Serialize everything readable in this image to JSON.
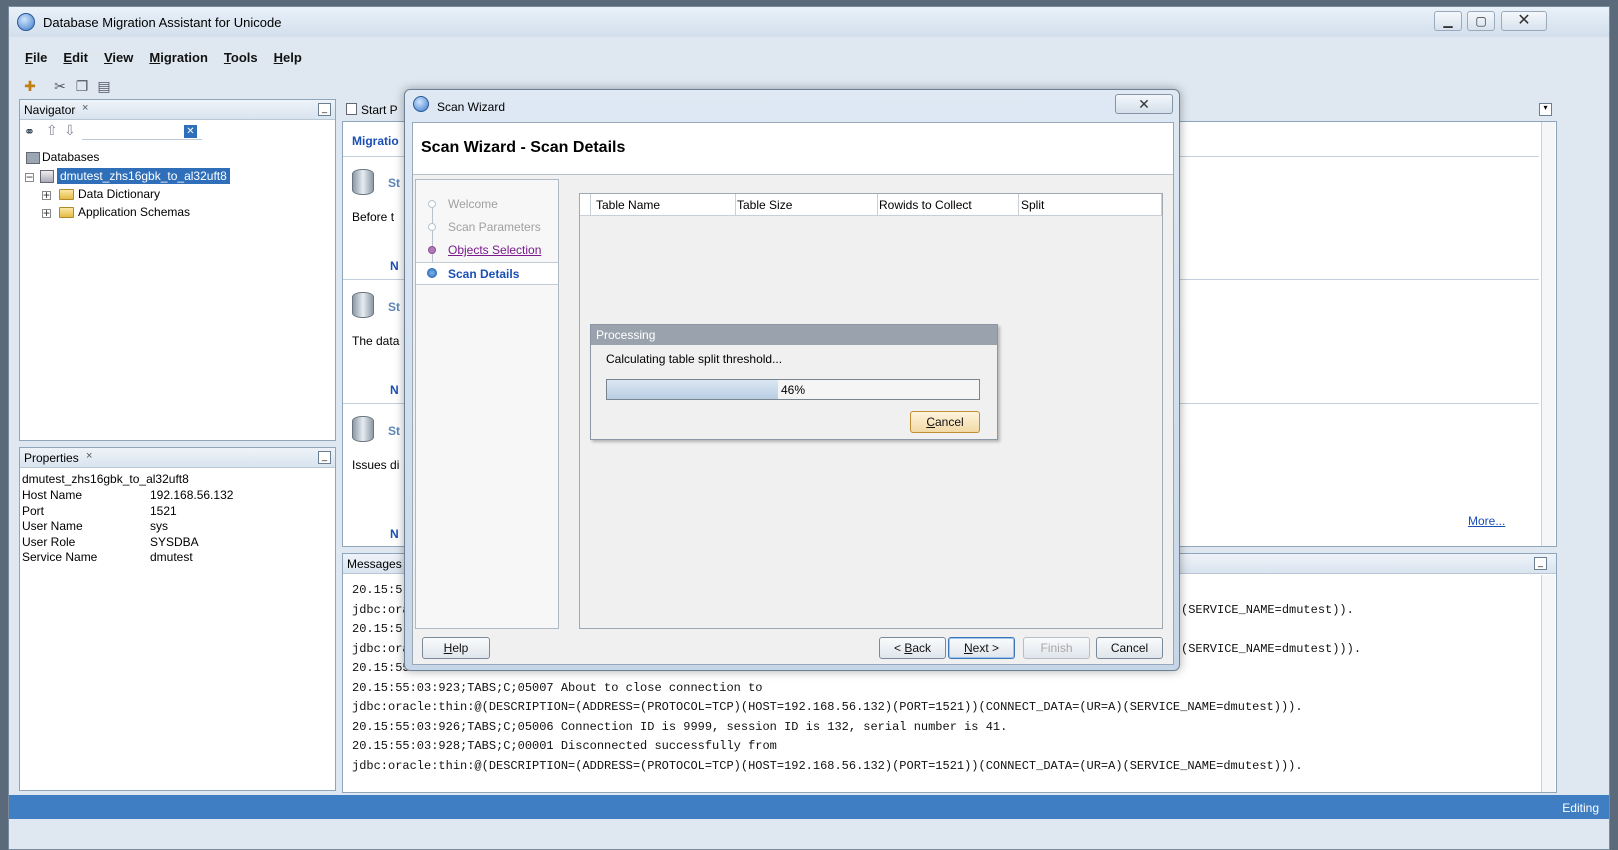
{
  "window": {
    "title": "Database Migration Assistant for Unicode"
  },
  "menu": [
    {
      "label": "File",
      "key": "F",
      "rest": "ile"
    },
    {
      "label": "Edit",
      "key": "E",
      "rest": "dit"
    },
    {
      "label": "View",
      "key": "V",
      "rest": "iew"
    },
    {
      "label": "Migration",
      "key": "M",
      "rest": "igration"
    },
    {
      "label": "Tools",
      "key": "T",
      "rest": "ools"
    },
    {
      "label": "Help",
      "key": "H",
      "rest": "elp"
    }
  ],
  "navigator": {
    "title": "Navigator",
    "close": "×",
    "root": "Databases",
    "connection": "dmutest_zhs16gbk_to_al32uft8",
    "children": [
      "Data Dictionary",
      "Application Schemas"
    ]
  },
  "properties": {
    "title": "Properties",
    "close": "×",
    "header": "dmutest_zhs16gbk_to_al32uft8",
    "rows": [
      {
        "k": "Host Name",
        "v": "192.168.56.132"
      },
      {
        "k": "Port",
        "v": "1521"
      },
      {
        "k": "User Name",
        "v": "sys"
      },
      {
        "k": "User Role",
        "v": "SYSDBA"
      },
      {
        "k": "Service Name",
        "v": "dmutest"
      }
    ]
  },
  "center": {
    "tab": "Start P",
    "heading": "Migratio",
    "card1_letter": "St",
    "card1_text": "Before t",
    "card1_link": "N",
    "card2_letter": "St",
    "card2_text": "The data",
    "card2_link": "N",
    "card3_letter": "St",
    "card3_text": "Issues di",
    "card3_link": "N",
    "more": "More..."
  },
  "messages": {
    "title": "Messages",
    "lines": [
      {
        "left": "20.15:5",
        "right": ""
      },
      {
        "left": "jdbc:ora",
        "right": "(SERVICE_NAME=dmutest))."
      },
      {
        "left": "20.15:5",
        "right": ""
      },
      {
        "left": "jdbc:ora",
        "right": "(SERVICE_NAME=dmutest)))."
      },
      {
        "left": "20.15:55:03:6",
        "right": ""
      },
      {
        "left": "20.15:55:03:923;TABS;C;05007 About to close connection to",
        "right": ""
      },
      {
        "left": "jdbc:oracle:thin:@(DESCRIPTION=(ADDRESS=(PROTOCOL=TCP)(HOST=192.168.56.132)(PORT=1521))(CONNECT_DATA=(UR=A)(SERVICE_NAME=dmutest))).",
        "right": ""
      },
      {
        "left": "20.15:55:03:926;TABS;C;05006 Connection ID is 9999, session ID is 132, serial number is 41.",
        "right": ""
      },
      {
        "left": "20.15:55:03:928;TABS;C;00001 Disconnected successfully from",
        "right": ""
      },
      {
        "left": "jdbc:oracle:thin:@(DESCRIPTION=(ADDRESS=(PROTOCOL=TCP)(HOST=192.168.56.132)(PORT=1521))(CONNECT_DATA=(UR=A)(SERVICE_NAME=dmutest))).",
        "right": ""
      }
    ]
  },
  "status": {
    "text": "Editing"
  },
  "dialog": {
    "title": "Scan Wizard",
    "header": "Scan Wizard - Scan Details",
    "steps": [
      "Welcome",
      "Scan Parameters",
      "Objects Selection",
      "Scan Details"
    ],
    "columns": [
      "Table Name",
      "Table Size",
      "Rowids to Collect",
      "Split"
    ],
    "processing": {
      "title": "Processing",
      "message": "Calculating table split threshold...",
      "percent": 46,
      "percent_label": "46%",
      "cancel": "Cancel"
    },
    "buttons": {
      "help": "Help",
      "back": "< Back",
      "next": "Next >",
      "finish": "Finish",
      "cancel": "Cancel"
    }
  },
  "colors": {
    "accent": "#3f7ec2",
    "selection": "#2f6fba",
    "link": "#1a4fb4",
    "visited": "#7a1a8c"
  }
}
